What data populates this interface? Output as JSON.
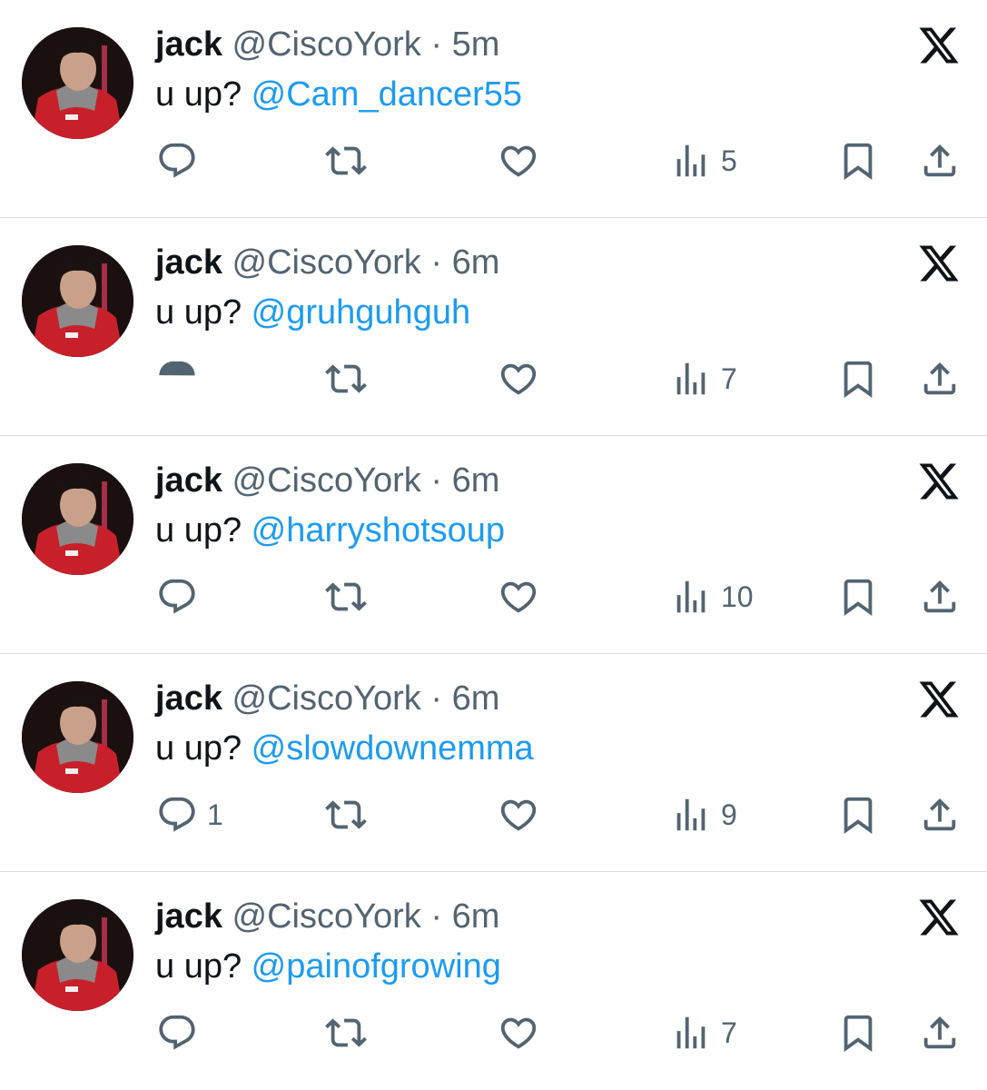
{
  "tweets": [
    {
      "name": "jack",
      "handle": "@CiscoYork",
      "dot": "·",
      "time": "5m",
      "text": "u up? ",
      "mention": "@Cam_dancer55",
      "replies": "",
      "views": "5"
    },
    {
      "name": "jack",
      "handle": "@CiscoYork",
      "dot": "·",
      "time": "6m",
      "text": "u up? ",
      "mention": "@gruhguhguh",
      "replies": "",
      "views": "7"
    },
    {
      "name": "jack",
      "handle": "@CiscoYork",
      "dot": "·",
      "time": "6m",
      "text": "u up? ",
      "mention": "@harryshotsoup",
      "replies": "",
      "views": "10"
    },
    {
      "name": "jack",
      "handle": "@CiscoYork",
      "dot": "·",
      "time": "6m",
      "text": "u up? ",
      "mention": "@slowdownemma",
      "replies": "1",
      "views": "9"
    },
    {
      "name": "jack",
      "handle": "@CiscoYork",
      "dot": "·",
      "time": "6m",
      "text": "u up? ",
      "mention": "@painofgrowing",
      "replies": "",
      "views": "7"
    }
  ],
  "icons": {
    "reply": "reply-icon",
    "repost": "repost-icon",
    "like": "heart-icon",
    "views": "views-icon",
    "bookmark": "bookmark-icon",
    "share": "share-icon",
    "logo": "x-logo-icon"
  },
  "colors": {
    "text": "#0f1419",
    "secondary": "#536471",
    "mention": "#1d9bf0",
    "divider": "#d9dde1"
  }
}
